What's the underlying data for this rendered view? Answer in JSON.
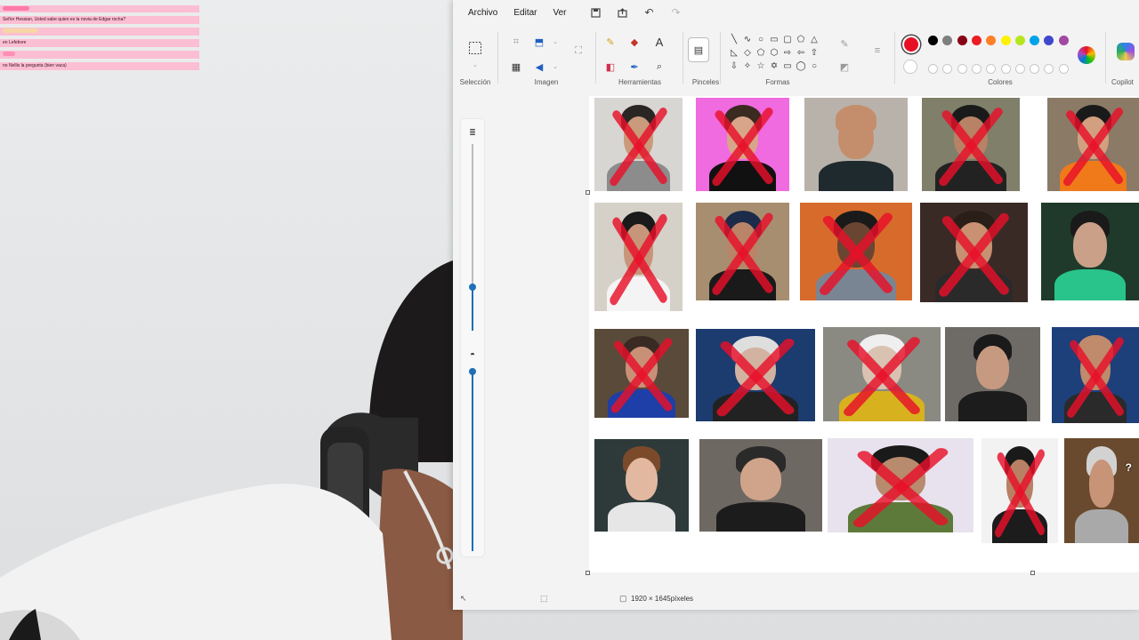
{
  "chat": {
    "lines": [
      "Señor Hessian, Usted sabe quien es la novia de Edgar rocha?",
      "",
      "en Lefebvre",
      "",
      "no Nellis la pregunta (bien vaca)"
    ]
  },
  "paint": {
    "menu": [
      "Archivo",
      "Editar",
      "Ver"
    ],
    "ribbon": {
      "groups": [
        "Selección",
        "Imagen",
        "Herramientas",
        "Pinceles",
        "Formas",
        "Colores",
        "Copilot"
      ]
    },
    "colors": {
      "selected": "#e81123",
      "palette": [
        "#000000",
        "#7f7f7f",
        "#880015",
        "#ed1c24",
        "#ff7f27",
        "#fff200",
        "#b5e61d",
        "#00a2e8",
        "#3f48cc",
        "#a349a4"
      ],
      "palette2": [
        "#ffffff",
        "#c3c3c3",
        "#b97a57",
        "#ffaec9",
        "#ffc90e",
        "#efe4b0",
        "#b5e61d",
        "#99d9ea",
        "#7092be",
        "#c8bfe7"
      ]
    },
    "status": {
      "dimensions": "1920 × 1645píxeles"
    }
  },
  "grid": {
    "rows": [
      [
        {
          "crossed": true,
          "bg": "#d8d6d3",
          "skin": "#c99a7c",
          "hair": "#2a2624",
          "shirt": "#8c8c8c"
        },
        {
          "crossed": true,
          "bg": "#f06ae0",
          "skin": "#d9a58a",
          "hair": "#3a2a20",
          "shirt": "#111111"
        },
        {
          "crossed": false,
          "bg": "#b9b2aa",
          "skin": "#c48e6c",
          "hair": "#c48e6c",
          "shirt": "#1f2a2e"
        },
        {
          "crossed": true,
          "bg": "#7f7f6a",
          "skin": "#b78266",
          "hair": "#1a1a1a",
          "shirt": "#222222"
        },
        {
          "crossed": true,
          "bg": "#8a7a66",
          "skin": "#d2a080",
          "hair": "#1a1a1a",
          "shirt": "#f07a1a"
        }
      ],
      [
        {
          "crossed": true,
          "bg": "#d6d1c8",
          "skin": "#c7967a",
          "hair": "#1a1a1a",
          "shirt": "#f4f4f4"
        },
        {
          "crossed": true,
          "bg": "#a88e70",
          "skin": "#b98468",
          "hair": "#1d2b4a",
          "shirt": "#1a1a1a"
        },
        {
          "crossed": true,
          "bg": "#d76b2c",
          "skin": "#6a4532",
          "hair": "#1a1a1a",
          "shirt": "#7a8593"
        },
        {
          "crossed": true,
          "bg": "#3a2a26",
          "skin": "#c89172",
          "hair": "#2a1e18",
          "shirt": "#2a2a2a"
        },
        {
          "crossed": false,
          "bg": "#1f3a2a",
          "skin": "#caa088",
          "hair": "#1a1a1a",
          "shirt": "#28c48c"
        }
      ],
      [
        {
          "crossed": true,
          "bg": "#5a4a3a",
          "skin": "#c99078",
          "hair": "#3a2a24",
          "shirt": "#1e3ea8"
        },
        {
          "crossed": true,
          "bg": "#1c3b6e",
          "skin": "#d2b2a0",
          "hair": "#dedede",
          "shirt": "#222222"
        },
        {
          "crossed": true,
          "bg": "#8a8a82",
          "skin": "#d9c2b2",
          "hair": "#efefef",
          "shirt": "#d8b21e"
        },
        {
          "crossed": false,
          "bg": "#6e6a66",
          "skin": "#c69a80",
          "hair": "#1a1a1a",
          "shirt": "#1c1c1c"
        },
        {
          "crossed": true,
          "bg": "#1d3f7a",
          "skin": "#c08a6c",
          "hair": "#c08a6c",
          "shirt": "#2a2a2a"
        }
      ],
      [
        {
          "crossed": false,
          "bg": "#2e3a3a",
          "skin": "#e2b8a0",
          "hair": "#7a4a2a",
          "shirt": "#e6e6e6"
        },
        {
          "crossed": false,
          "bg": "#6d6862",
          "skin": "#d0a48a",
          "hair": "#2a2a2a",
          "shirt": "#1c1c1c"
        },
        {
          "crossed": true,
          "bg": "#e8e2ee",
          "skin": "#b88a6e",
          "hair": "#1a1a1a",
          "shirt": "#5e7a3a"
        },
        {
          "crossed": true,
          "bg": "#f2f2f2",
          "skin": "#b88064",
          "hair": "#1a1a1a",
          "shirt": "#1c1c1c"
        },
        {
          "crossed": false,
          "bg": "#6a4a2e",
          "skin": "#c89478",
          "hair": "#d2d2d2",
          "shirt": "#a9a9a9"
        }
      ]
    ],
    "unknown_mark": "?"
  }
}
